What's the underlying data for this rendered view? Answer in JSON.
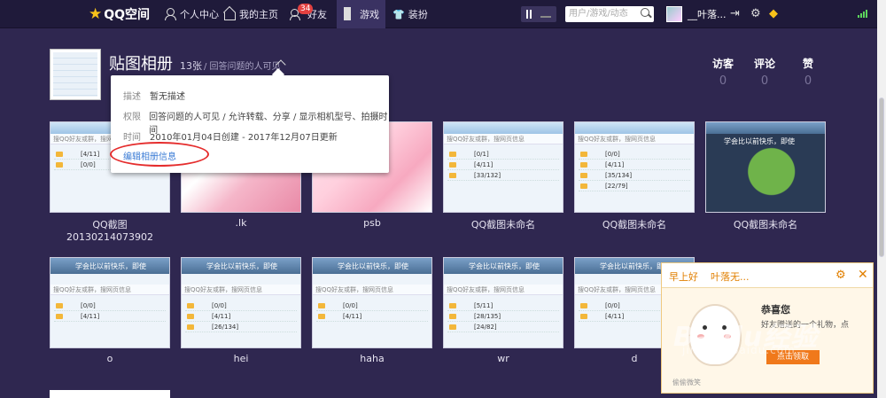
{
  "topbar": {
    "logo": "QQ空间",
    "nav": [
      {
        "label": "个人中心",
        "icon": "user-icon"
      },
      {
        "label": "我的主页",
        "icon": "home-icon"
      },
      {
        "label": "好友",
        "icon": "friends-icon",
        "badge": "34"
      },
      {
        "label": "游戏",
        "icon": "game-icon",
        "active": true
      },
      {
        "label": "装扮",
        "icon": "shirt-icon"
      }
    ],
    "search_placeholder": "用户/游戏/动态",
    "username": "__叶落...",
    "accent": "#f7c21a"
  },
  "album": {
    "title": "贴图相册",
    "count": "13张",
    "visibility": "/ 回答问题的人可见",
    "stats": [
      {
        "label": "访客",
        "value": "0"
      },
      {
        "label": "评论",
        "value": "0"
      },
      {
        "label": "赞",
        "value": "0"
      }
    ]
  },
  "info_popup": {
    "desc_label": "描述",
    "desc_value": "暂无描述",
    "perm_label": "权限",
    "perm_value": "回答问题的人可见 / 允许转载、分享 / 显示相机型号、拍摄时间",
    "time_label": "时间",
    "time_value": "2010年01月04日创建 - 2017年12月07日更新",
    "edit_link": "编辑相册信息"
  },
  "photos_row1": [
    {
      "caption": "QQ截图20130214073902"
    },
    {
      "caption": ".lk"
    },
    {
      "caption": "psb"
    },
    {
      "caption": "QQ截图未命名"
    },
    {
      "caption": "QQ截图未命名"
    },
    {
      "caption": "QQ截图未命名"
    }
  ],
  "photos_row2": [
    {
      "caption": "o"
    },
    {
      "caption": "hei"
    },
    {
      "caption": "haha"
    },
    {
      "caption": "wr"
    },
    {
      "caption": "d"
    }
  ],
  "thumb_text": {
    "qq_search": "搜QQ好友或群，搜网页信息",
    "row_a": "[0/1]",
    "row_b": "[4/11]",
    "row_c": "[33/132]",
    "row_d": "[35/134]",
    "row_e": "[22/79]",
    "row_f": "[0/0]",
    "row_g": "[26/134]",
    "row_h": "[5/11]",
    "row_i": "[28/135]",
    "row_j": "[24/82]",
    "banner": "学会比以前快乐，即使"
  },
  "gift": {
    "greeting": "早上好",
    "name": "叶落无...",
    "congrats": "恭喜您",
    "message": "好友赠送的一个礼物，点",
    "button": "点击领取",
    "footer": "偷偷微笑"
  },
  "watermark": {
    "main": "Baidu经验",
    "sub": "jingyan.baidu.com"
  }
}
